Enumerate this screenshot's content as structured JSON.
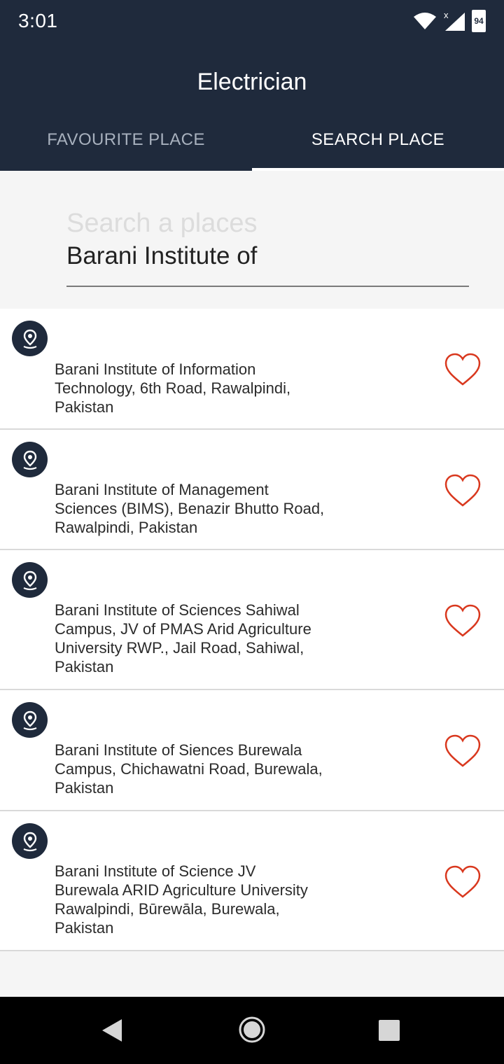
{
  "status_bar": {
    "time": "3:01",
    "battery": "94"
  },
  "app_bar": {
    "title": "Electrician",
    "tabs": [
      {
        "label": "FAVOURITE PLACE",
        "active": false
      },
      {
        "label": "SEARCH PLACE",
        "active": true
      }
    ]
  },
  "search": {
    "placeholder": "Search a places",
    "value": "Barani Institute of"
  },
  "results": [
    {
      "lines": [
        "Barani Institute of Information",
        "Technology, 6th Road, Rawalpindi,",
        "Pakistan"
      ]
    },
    {
      "lines": [
        "Barani Institute of Management",
        "Sciences (BIMS), Benazir Bhutto Road,",
        "Rawalpindi, Pakistan"
      ]
    },
    {
      "lines": [
        "Barani Institute of Sciences Sahiwal",
        "Campus, JV of PMAS Arid Agriculture",
        "University RWP., Jail Road, Sahiwal,",
        "Pakistan"
      ]
    },
    {
      "lines": [
        "Barani Institute of Siences Burewala",
        "Campus, Chichawatni Road, Burewala,",
        "Pakistan"
      ]
    },
    {
      "lines": [
        "Barani Institute of Science JV",
        "Burewala ARID Agriculture University",
        "Rawalpindi, Būrewāla, Burewala,",
        "Pakistan"
      ]
    }
  ],
  "colors": {
    "primary": "#1f2a3c",
    "heart": "#d9381e"
  },
  "icons": {
    "location": "location-pin-icon",
    "favourite": "heart-outline-icon"
  }
}
